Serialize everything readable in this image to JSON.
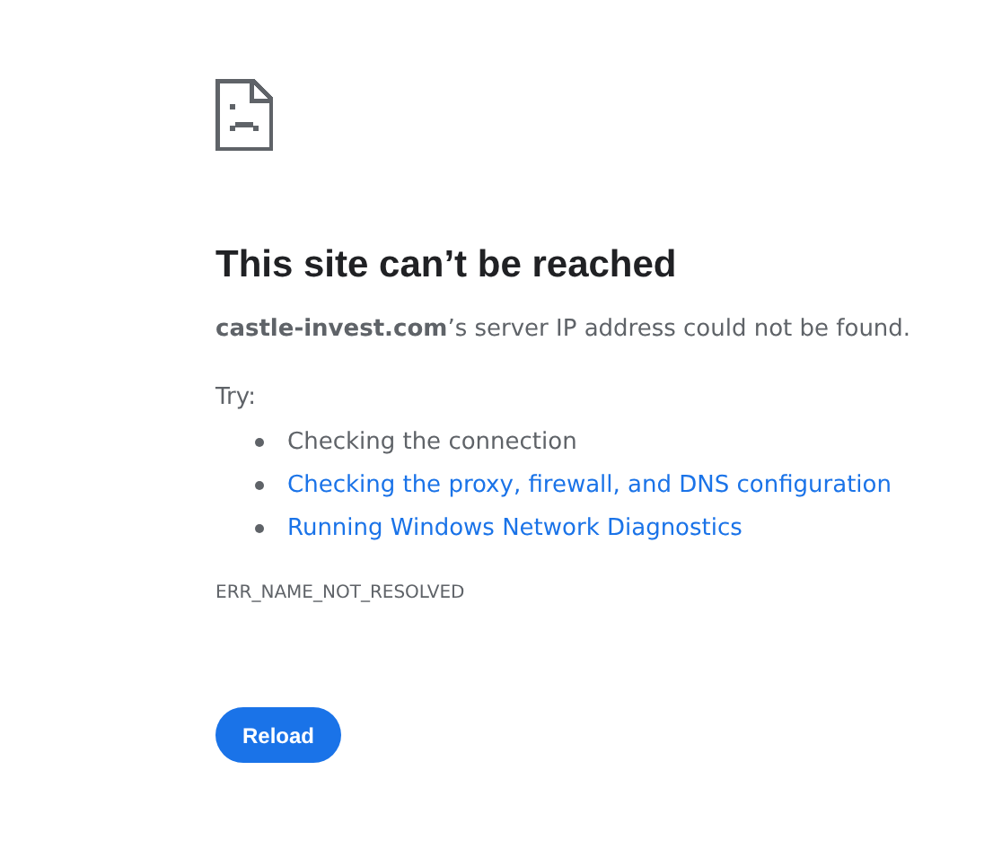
{
  "heading": "This site can’t be reached",
  "message": "**castle-invest.com**’s server IP address could not be found.",
  "try_label": "Try:",
  "suggestions": [
    {
      "kind": "text",
      "label": "Checking the connection"
    },
    {
      "kind": "link",
      "label": "Checking the proxy, firewall, and DNS configuration"
    },
    {
      "kind": "link",
      "label": "Running Windows Network Diagnostics"
    }
  ],
  "error_code": "ERR_NAME_NOT_RESOLVED",
  "button": "Reload"
}
